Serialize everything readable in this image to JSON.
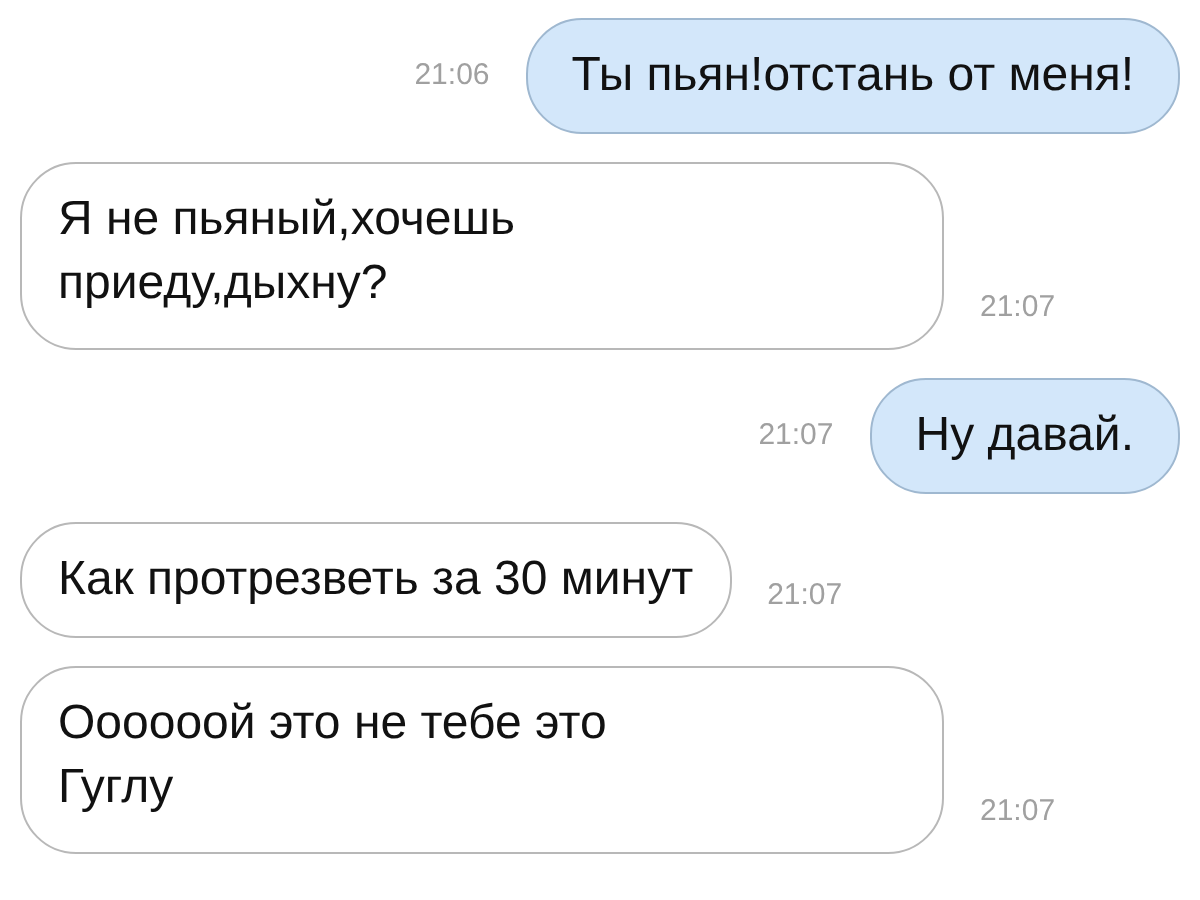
{
  "messages": [
    {
      "kind": "sent",
      "lines": [
        "Ты пьян!отстань от меня!"
      ],
      "time": "21:06"
    },
    {
      "kind": "received",
      "lines": [
        "Я не пьяный,хочешь",
        "приеду,дыхну?"
      ],
      "time": "21:07"
    },
    {
      "kind": "sent",
      "lines": [
        "Ну давай."
      ],
      "time": "21:07"
    },
    {
      "kind": "received",
      "lines": [
        "Как протрезветь за 30 минут"
      ],
      "time": "21:07"
    },
    {
      "kind": "received",
      "lines": [
        "Оооооой это не тебе это",
        "Гуглу"
      ],
      "time": "21:07"
    }
  ]
}
